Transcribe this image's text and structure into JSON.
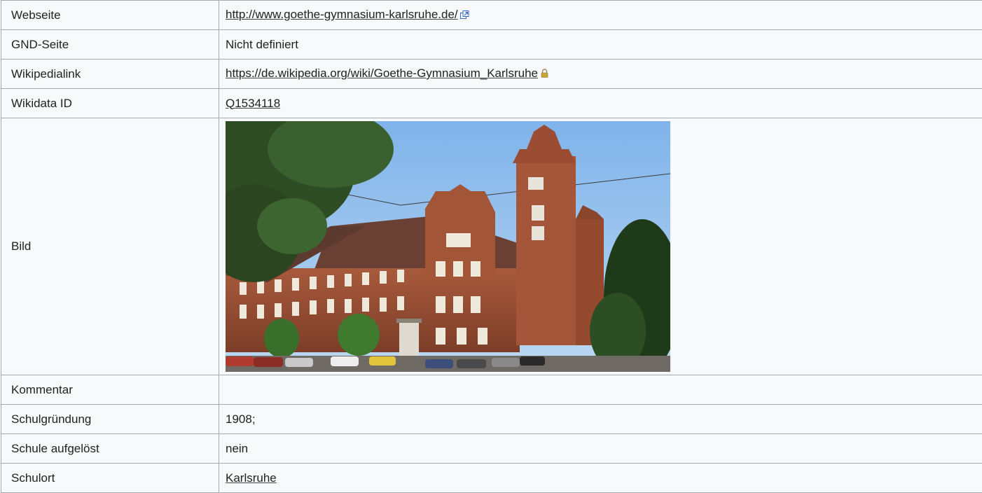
{
  "rows": [
    {
      "key": "Webseite",
      "value": "http://www.goethe-gymnasium-karlsruhe.de/",
      "kind": "external-link",
      "icon": "external-link-icon"
    },
    {
      "key": "GND-Seite",
      "value": "Nicht definiert",
      "kind": "text"
    },
    {
      "key": "Wikipedialink",
      "value": "https://de.wikipedia.org/wiki/Goethe-Gymnasium_Karlsruhe",
      "kind": "secure-link",
      "icon": "lock-icon"
    },
    {
      "key": "Wikidata ID",
      "value": "Q1534118",
      "kind": "link"
    },
    {
      "key": "Bild",
      "value": "",
      "kind": "image",
      "image": "building-photo"
    },
    {
      "key": "Kommentar",
      "value": "",
      "kind": "text"
    },
    {
      "key": "Schulgründung",
      "value": "1908;",
      "kind": "text"
    },
    {
      "key": "Schule aufgelöst",
      "value": "nein",
      "kind": "text"
    },
    {
      "key": "Schulort",
      "value": "Karlsruhe",
      "kind": "link"
    }
  ],
  "colors": {
    "border": "#a2a9b1",
    "cell_bg": "#f8f9fa",
    "text": "#222222",
    "external_icon": "#3366cc",
    "lock_icon": "#c9a634"
  }
}
